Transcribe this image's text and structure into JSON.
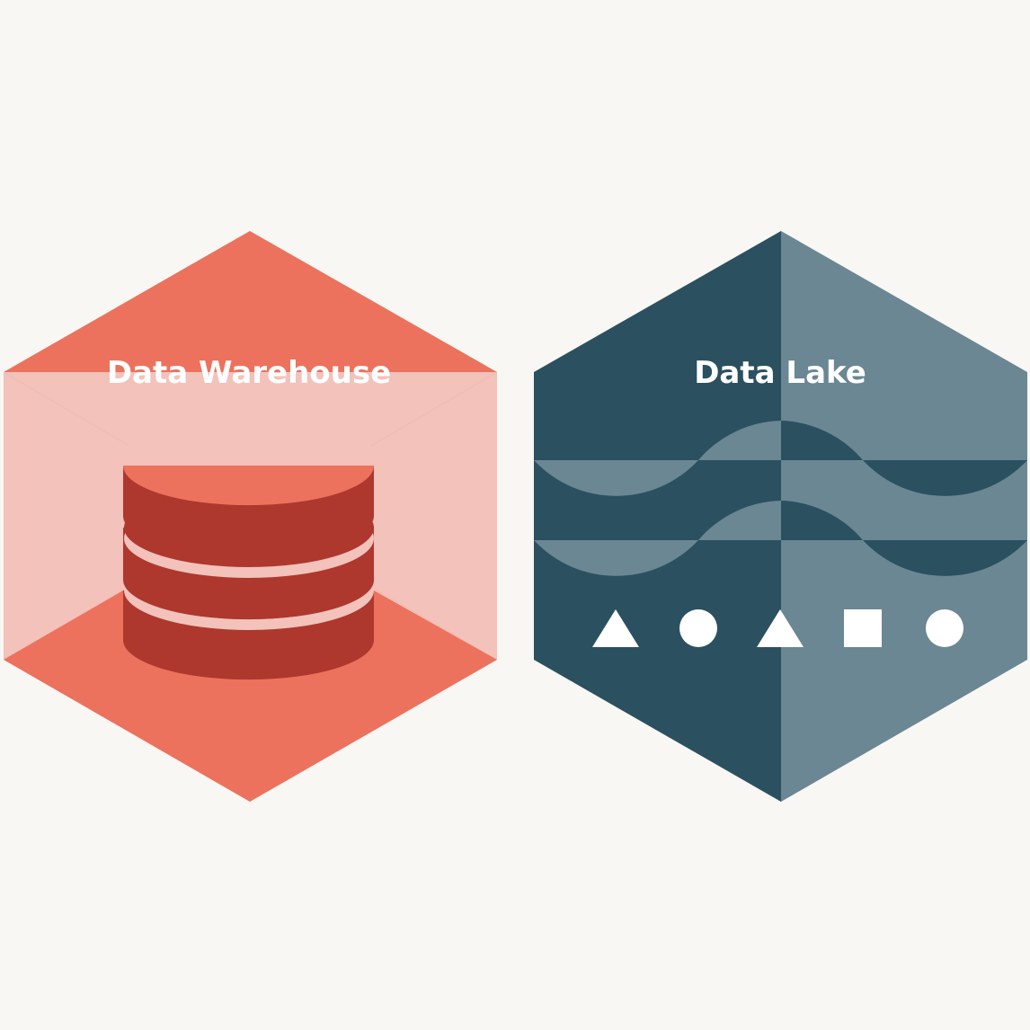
{
  "background_color": "#f8f7f3",
  "warehouse": {
    "title": "Data Warehouse",
    "icon": "database-cylinder-icon",
    "colors": {
      "hex_main": "#ec725d",
      "hex_light": "#f2c2bb",
      "cylinder_dark": "#ae382e",
      "cylinder_top": "#ec725d"
    }
  },
  "lake": {
    "title": "Data Lake",
    "icon": "waves-icon",
    "shapes": [
      "triangle",
      "circle",
      "triangle",
      "square",
      "circle"
    ],
    "colors": {
      "hex_dark": "#2b5060",
      "hex_light": "#6a8793",
      "shape_fill": "#ffffff"
    }
  }
}
